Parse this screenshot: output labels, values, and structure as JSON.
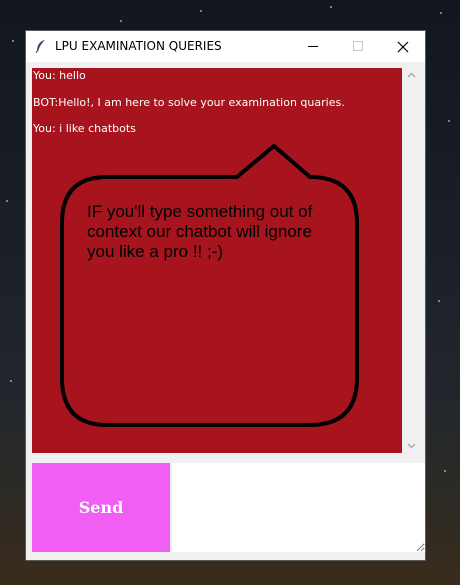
{
  "window": {
    "title": "LPU EXAMINATION QUERIES",
    "icon": "feather-icon"
  },
  "chat": {
    "background": "#a8141d",
    "messages": [
      "You: hello",
      "BOT:Hello!, I am here to solve your examination quaries.",
      "You: i like chatbots"
    ],
    "bubble_text": "IF you'll type something out of context our chatbot will ignore you like a pro !! ;-)"
  },
  "input": {
    "value": "",
    "placeholder": ""
  },
  "send": {
    "label": "Send",
    "color": "#f05ef4"
  }
}
